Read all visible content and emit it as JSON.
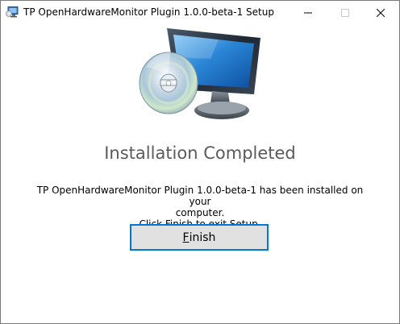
{
  "window": {
    "title": "TP OpenHardwareMonitor Plugin 1.0.0-beta-1 Setup",
    "icon": "setup-app-icon",
    "controls": {
      "minimize_icon": "minimize-icon",
      "maximize_icon": "maximize-icon",
      "close_icon": "close-icon"
    }
  },
  "hero": {
    "icon": "monitor-with-cd-icon"
  },
  "content": {
    "heading": "Installation Completed",
    "message_line1": "TP OpenHardwareMonitor Plugin 1.0.0-beta-1 has been installed on your",
    "message_line2": "computer.",
    "message_line3": "Click Finish to exit Setup."
  },
  "actions": {
    "finish_accelerator": "F",
    "finish_rest": "inish"
  },
  "colors": {
    "heading": "#5a5a5a",
    "button_bg": "#e1e1e1",
    "button_focus_border": "#0078d7",
    "window_border": "#7a7a7a"
  }
}
